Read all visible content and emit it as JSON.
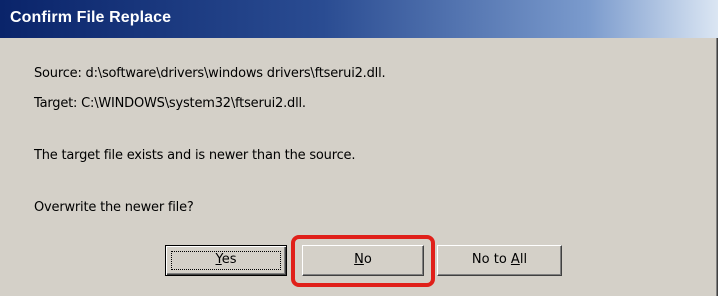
{
  "dialog": {
    "title": "Confirm File Replace",
    "source_line": "Source: d:\\software\\drivers\\windows drivers\\ftserui2.dll.",
    "target_line": "Target: C:\\WINDOWS\\system32\\ftserui2.dll.",
    "info_line": "The target file exists and is newer than the source.",
    "question_line": "Overwrite the newer file?"
  },
  "buttons": {
    "yes": {
      "mnemonic": "Y",
      "rest": "es"
    },
    "no": {
      "mnemonic": "N",
      "rest": "o"
    },
    "no_to_all": {
      "prefix": "No to ",
      "mnemonic": "A",
      "rest": "ll"
    }
  },
  "colors": {
    "title_bar_start": "#0a246a",
    "title_bar_end": "#dbe6f3",
    "dialog_face": "#d4d0c8",
    "highlight": "#e0201a"
  }
}
